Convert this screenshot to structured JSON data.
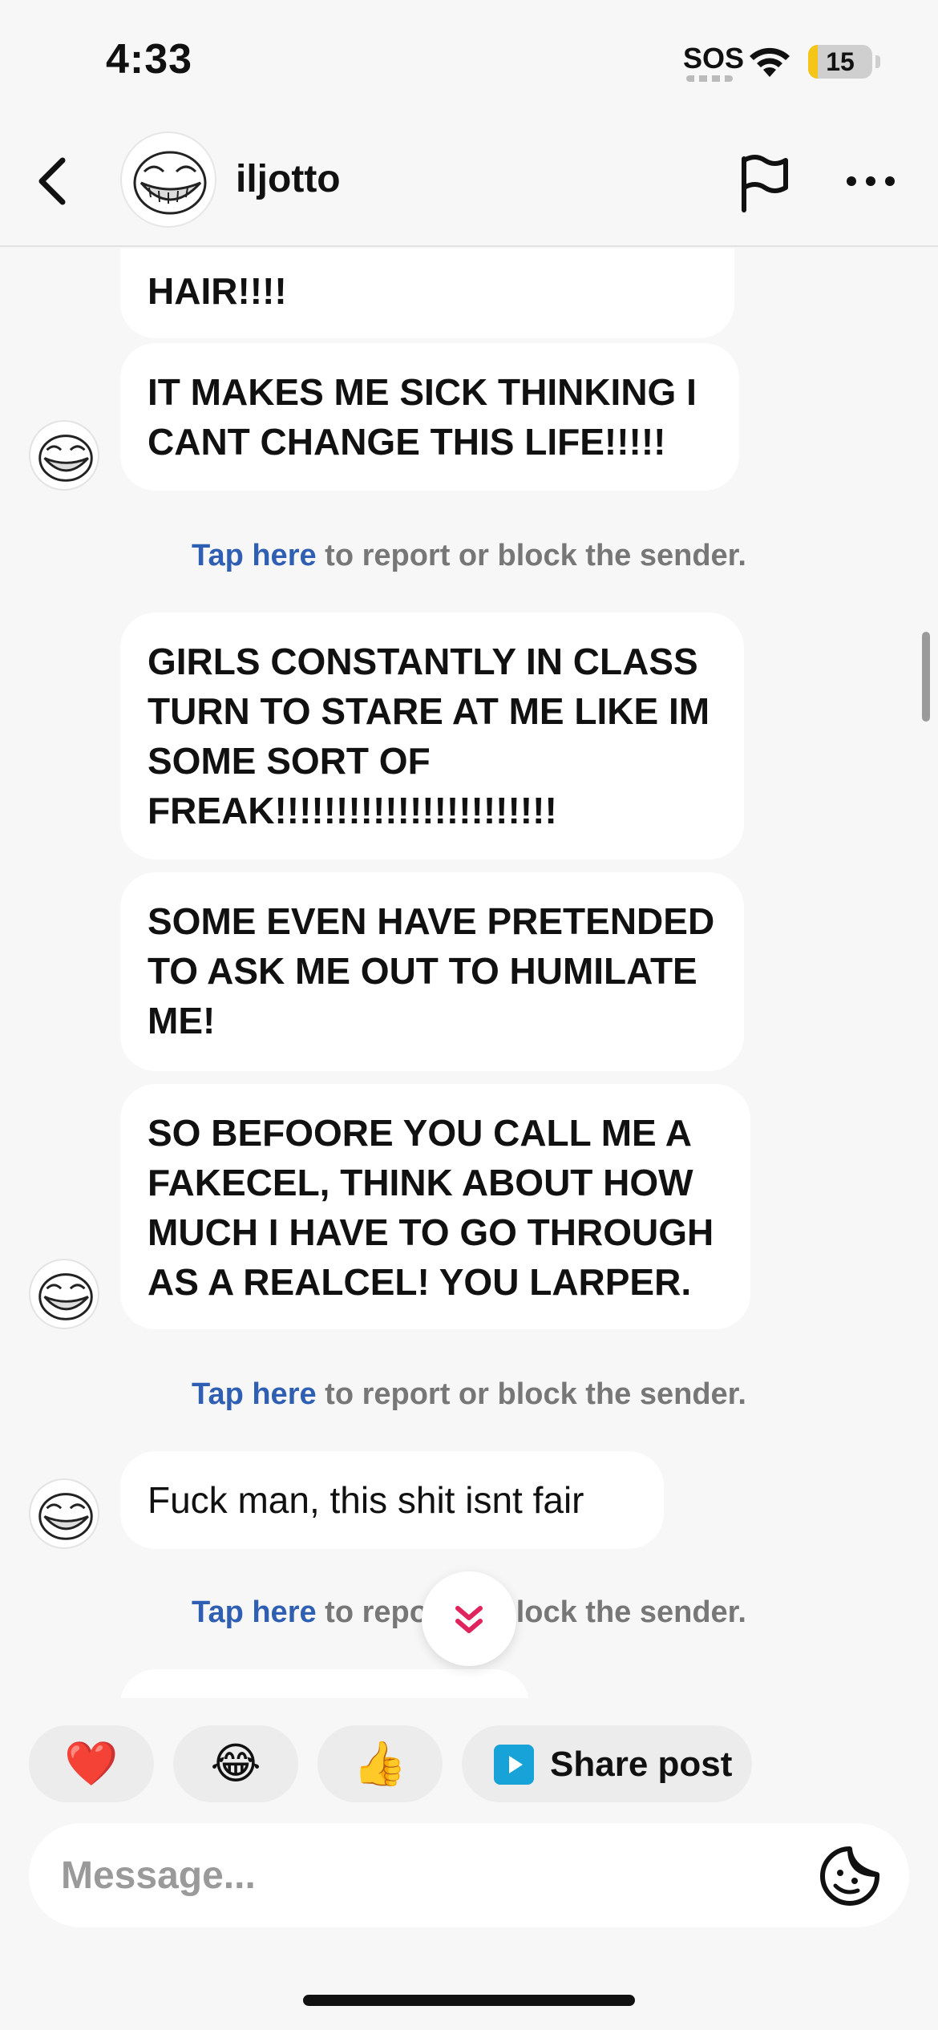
{
  "status_bar": {
    "time": "4:33",
    "sos": "SOS",
    "battery_level": "15",
    "battery_fraction": 0.15,
    "battery_color": "#f5c518",
    "wifi_icon": "wifi-icon"
  },
  "header": {
    "username": "iljotto",
    "back_icon": "chevron-left-icon",
    "flag_icon": "flag-icon",
    "more_icon": "more-horizontal-icon"
  },
  "messages": [
    {
      "text": "HAIR!!!!"
    },
    {
      "text": "IT MAKES ME SICK THINKING I CANT CHANGE THIS LIFE!!!!!"
    },
    {
      "text": "GIRLS CONSTANTLY IN CLASS TURN TO STARE AT ME LIKE IM SOME SORT OF FREAK!!!!!!!!!!!!!!!!!!!!!!!"
    },
    {
      "text": "SOME EVEN HAVE PRETENDED TO ASK ME OUT TO HUMILATE ME!"
    },
    {
      "text": "SO BEFOORE YOU CALL ME A FAKECEL, THINK ABOUT HOW MUCH I HAVE TO GO THROUGH AS A REALCEL! YOU LARPER."
    },
    {
      "text": "Fuck man, this shit isnt fair"
    }
  ],
  "notice": {
    "link": "Tap here",
    "rest": " to report or block the sender."
  },
  "quick_replies": {
    "heart": "❤️",
    "laugh": "😂",
    "thumbs_up": "👍",
    "share_post": "Share post"
  },
  "composer": {
    "placeholder": "Message...",
    "sticker_icon": "sticker-icon"
  },
  "colors": {
    "link": "#2f5fb3",
    "scroll_chevron": "#e0245e",
    "background": "#f7f7f7"
  }
}
